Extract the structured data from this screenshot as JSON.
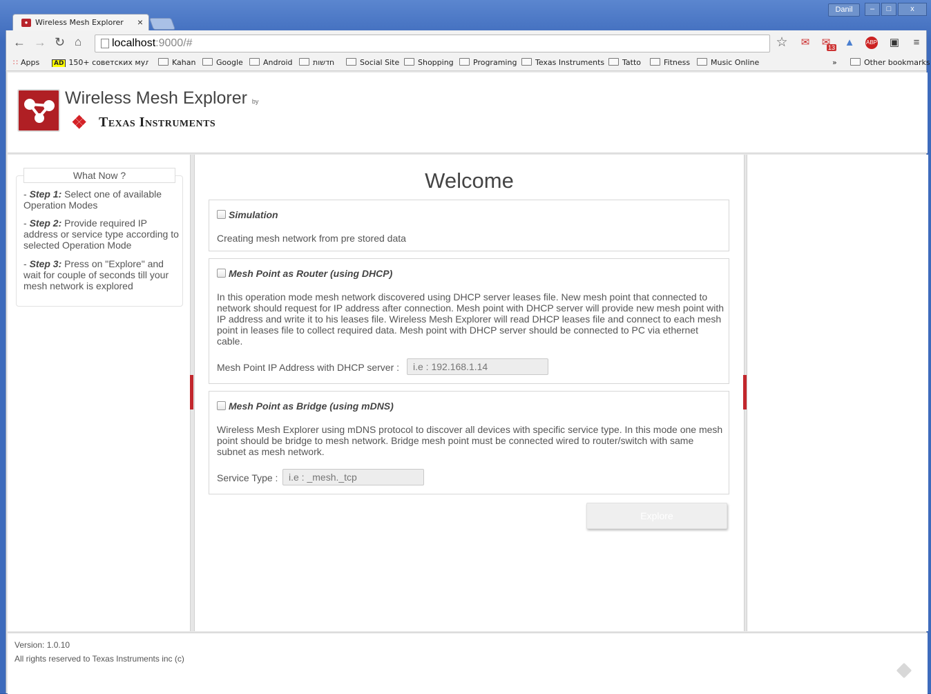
{
  "browser": {
    "tab_title": "Wireless Mesh Explorer",
    "tab_close": "×",
    "user_name": "Danil",
    "url_host": "localhost",
    "url_rest": ":9000/#",
    "bookmarks": [
      "Apps",
      "150+ советских мульт",
      "Kahan",
      "Google",
      "Android",
      "חדשות",
      "Social Site",
      "Shopping",
      "Programing",
      "Texas Instruments",
      "Tatto",
      "Fitness",
      "Music Online"
    ],
    "bookmarks_overflow": "»",
    "other_bookmarks": "Other bookmarks",
    "mail_badge": "13"
  },
  "header": {
    "app_title": "Wireless Mesh Explorer",
    "by": "by",
    "company": "Texas Instruments"
  },
  "sidebar": {
    "heading": "What Now ?",
    "steps": [
      {
        "label": "Step 1:",
        "text": "Select one of available Operation Modes"
      },
      {
        "label": "Step 2:",
        "text": "Provide required IP address or service type according to selected Operation Mode"
      },
      {
        "label": "Step 3:",
        "text": "Press on \"Explore\" and wait for couple of seconds till your mesh network is explored"
      }
    ]
  },
  "main": {
    "title": "Welcome",
    "modes": [
      {
        "title": "Simulation",
        "desc": "Creating mesh network from pre stored data"
      },
      {
        "title": "Mesh Point as Router (using DHCP)",
        "desc": "In this operation mode mesh network discovered using DHCP server leases file. New mesh point that connected to network should request for IP address after connection. Mesh point with DHCP server will provide new mesh point with IP address and write it to his leases file. Wireless Mesh Explorer will read DHCP leases file and connect to each mesh point in leases file to collect required data. Mesh point with DHCP server should be connected to PC via ethernet cable.",
        "field_label": "Mesh Point IP Address with DHCP server :",
        "placeholder": "i.e : 192.168.1.14"
      },
      {
        "title": "Mesh Point as Bridge (using mDNS)",
        "desc": "Wireless Mesh Explorer using mDNS protocol to discover all devices with specific service type. In this mode one mesh point should be bridge to mesh network. Bridge mesh point must be connected wired to router/switch with same subnet as mesh network.",
        "field_label": "Service Type :",
        "placeholder": "i.e : _mesh._tcp"
      }
    ],
    "explore_label": "Explore"
  },
  "footer": {
    "version": "Version: 1.0.10",
    "rights": "All rights reserved to Texas Instruments inc (c)"
  }
}
